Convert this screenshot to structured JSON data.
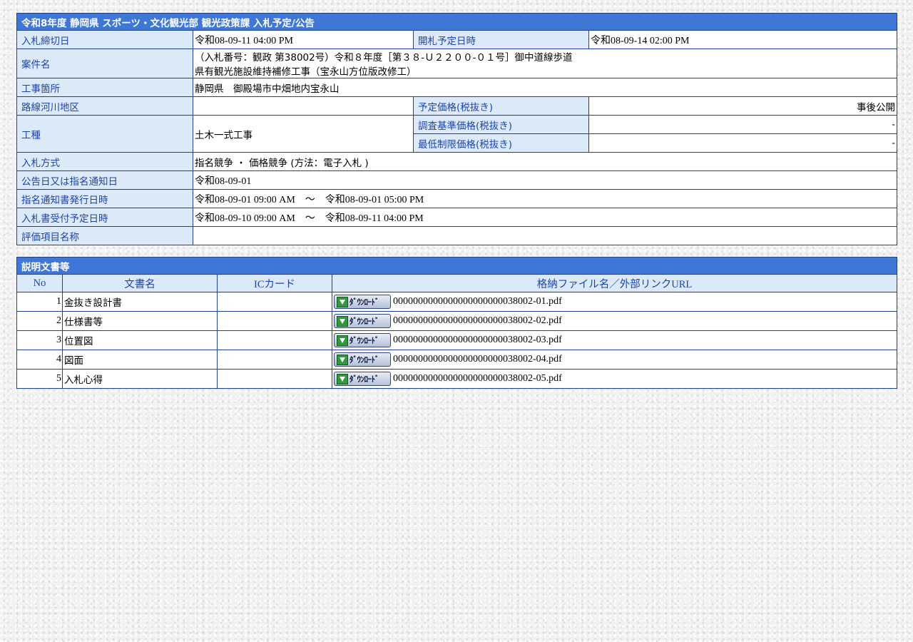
{
  "info": {
    "title": "令和8年度 静岡県 スポーツ・文化観光部 観光政策課 入札予定/公告",
    "deadline_label": "入札締切日",
    "deadline_value": "令和08-09-11 04:00 PM",
    "opening_label": "開札予定日時",
    "opening_value": "令和08-09-14 02:00 PM",
    "project_label": "案件名",
    "project_line1": "（入札番号：観政 第38002号）令和８年度［第３８-Ｕ２２００-０１号］御中道線歩道",
    "project_line2": "県有観光施設維持補修工事（宝永山方位版改修工）",
    "location_label": "工事箇所",
    "location_value": "静岡県　御殿場市中畑地内宝永山",
    "route_label": "路線河川地区",
    "route_value": "",
    "planned_price_label": "予定価格(税抜き)",
    "planned_price_value": "事後公開",
    "work_type_label": "工種",
    "work_type_value": "土木一式工事",
    "survey_price_label": "調査基準価格(税抜き)",
    "survey_price_value": "-",
    "min_price_label": "最低制限価格(税抜き)",
    "min_price_value": "-",
    "method_label": "入札方式",
    "method_value": "指名競争 ・ 価格競争 (方法：電子入札 )",
    "notice_label": "公告日又は指名通知日",
    "notice_value": "令和08-09-01",
    "issue_label": "指名通知書発行日時",
    "issue_value": "令和08-09-01 09:00 AM　～　令和08-09-01 05:00 PM",
    "receipt_label": "入札書受付予定日時",
    "receipt_value": "令和08-09-10 09:00 AM　～　令和08-09-11 04:00 PM",
    "eval_label": "評価項目名称",
    "eval_value": ""
  },
  "docs": {
    "title": "説明文書等",
    "headers": {
      "no": "No",
      "name": "文書名",
      "ic": "ICカード",
      "file": "格納ファイル名／外部リンクURL"
    },
    "download_label": "ﾀﾞｳﾝﾛｰﾄﾞ",
    "rows": [
      {
        "no": "1",
        "name": "金抜き設計書",
        "ic": "",
        "file": "0000000000000000000000038002-01.pdf"
      },
      {
        "no": "2",
        "name": "仕様書等",
        "ic": "",
        "file": "0000000000000000000000038002-02.pdf"
      },
      {
        "no": "3",
        "name": "位置図",
        "ic": "",
        "file": "0000000000000000000000038002-03.pdf"
      },
      {
        "no": "4",
        "name": "図面",
        "ic": "",
        "file": "0000000000000000000000038002-04.pdf"
      },
      {
        "no": "5",
        "name": "入札心得",
        "ic": "",
        "file": "0000000000000000000000038002-05.pdf"
      }
    ]
  },
  "colors": {
    "title_bg": "#3f77d6",
    "label_bg": "#dce9f8",
    "label_text": "#1f45a8",
    "border": "#1f3f8f"
  }
}
